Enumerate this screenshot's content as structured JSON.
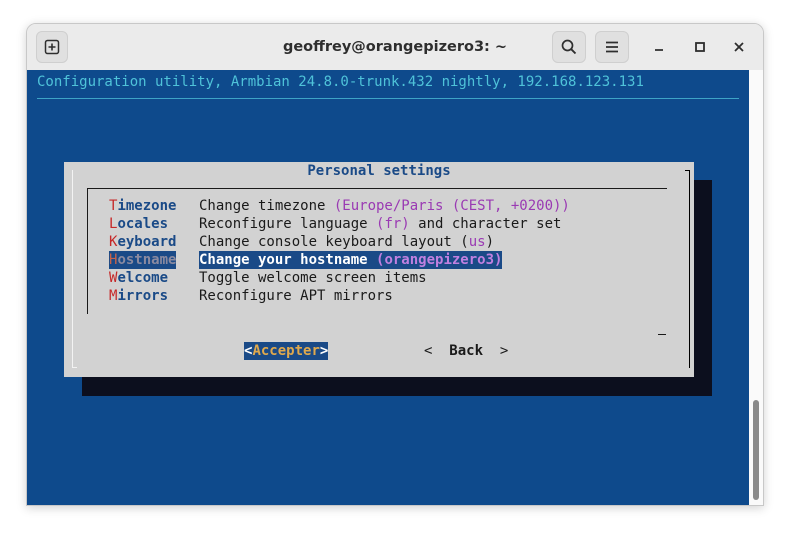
{
  "window": {
    "title": "geoffrey@orangepizero3: ~",
    "icons": {
      "new_tab": "new-tab-icon",
      "search": "search-icon",
      "menu": "hamburger-menu-icon",
      "minimize": "minimize-icon",
      "maximize": "maximize-icon",
      "close": "close-icon"
    }
  },
  "terminal": {
    "header": "Configuration utility, Armbian 24.8.0-trunk.432 nightly, 192.168.123.131",
    "dialog": {
      "title": "Personal settings",
      "selected_index": 3,
      "items": [
        {
          "hot": "T",
          "rest": "imezone",
          "desc": "Change timezone ",
          "paren": "(Europe/Paris (CEST, +0200))",
          "tail": ""
        },
        {
          "hot": "L",
          "rest": "ocales",
          "desc": "Reconfigure language ",
          "paren": "(fr)",
          "tail": " and character set"
        },
        {
          "hot": "K",
          "rest": "eyboard",
          "desc": "Change console keyboard layout (",
          "paren": "us",
          "tail": ")"
        },
        {
          "hot": "H",
          "rest": "ostname",
          "desc": "Change your hostname ",
          "paren": "(orangepizero3)",
          "tail": ""
        },
        {
          "hot": "W",
          "rest": "elcome",
          "desc": "Toggle welcome screen items",
          "paren": "",
          "tail": ""
        },
        {
          "hot": "M",
          "rest": "irrors",
          "desc": "Reconfigure APT mirrors",
          "paren": "",
          "tail": ""
        }
      ],
      "buttons": {
        "ok_open": "<",
        "ok_label": "Accepter",
        "ok_close": ">",
        "back_open": "<  ",
        "back_label": "Back",
        "back_close": "  >"
      }
    }
  },
  "colors": {
    "terminal_bg": "#0e4a8c",
    "dialog_bg": "#d2d2d2",
    "header_text": "#4fc3d9",
    "hotkey": "#c62828",
    "tag_text": "#1a4a87",
    "paren_text": "#9a3ab3",
    "selection_bg": "#1a4a87"
  }
}
